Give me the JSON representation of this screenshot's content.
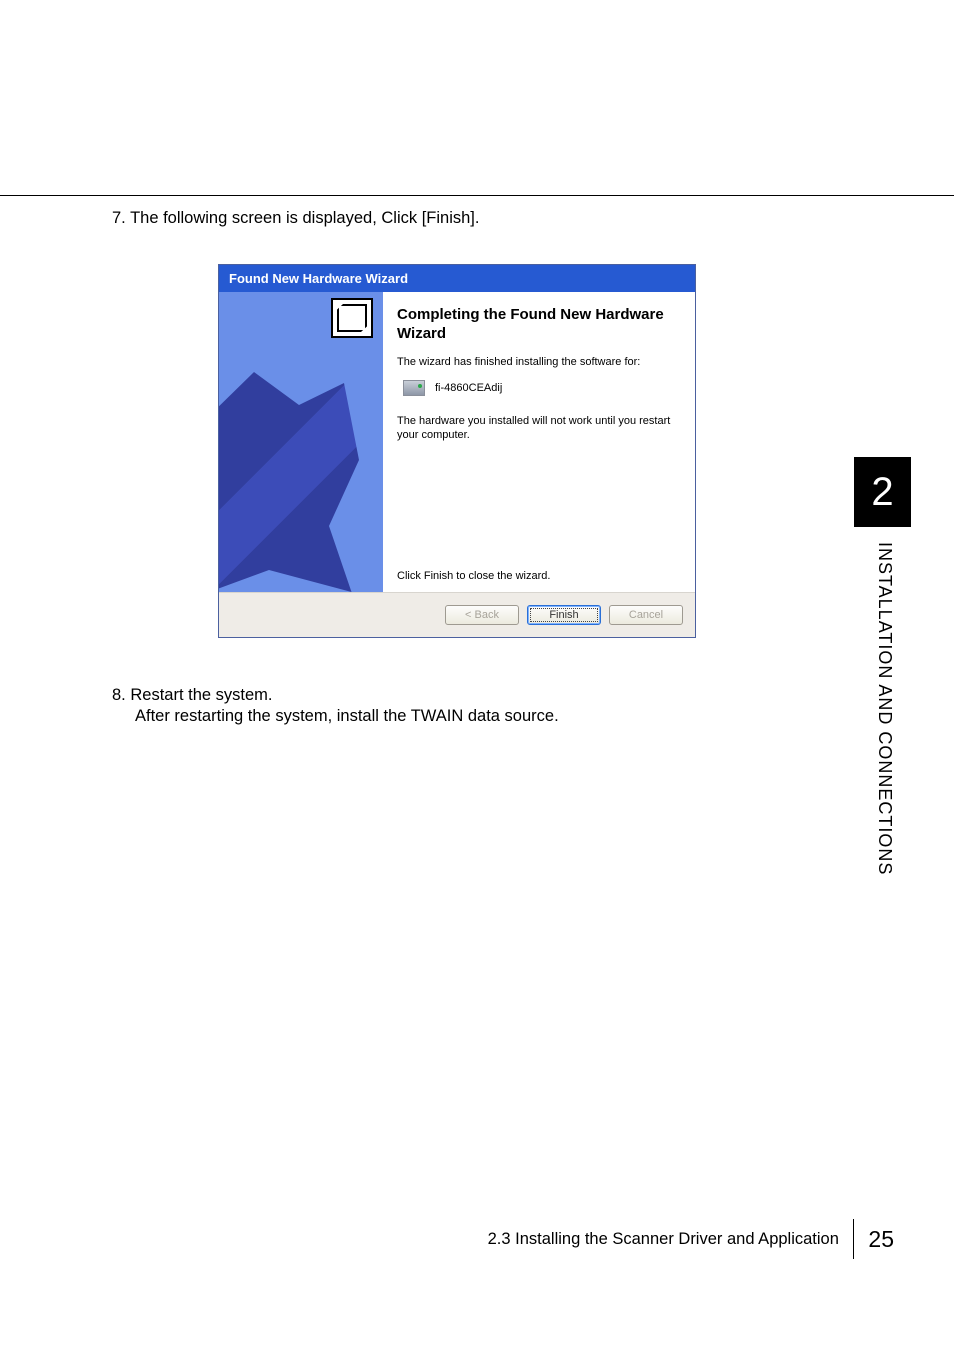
{
  "steps": {
    "s7": {
      "num": "7.",
      "text": "The following screen is displayed, Click [Finish]."
    },
    "s8": {
      "num": "8.",
      "text": "Restart the system.",
      "sub": "After restarting the system, install the TWAIN data source."
    }
  },
  "wizard": {
    "title": "Found New Hardware Wizard",
    "heading": "Completing the Found New Hardware Wizard",
    "sub": "The wizard has finished installing the software for:",
    "device": "fi-4860CEAdij",
    "note": "The hardware you installed will not work until you restart your computer.",
    "close_hint": "Click Finish to close the wizard.",
    "buttons": {
      "back": "< Back",
      "finish": "Finish",
      "cancel": "Cancel"
    }
  },
  "side": {
    "chapter": "2",
    "title": "INSTALLATION AND CONNECTIONS"
  },
  "footer": {
    "section": "2.3 Installing the Scanner Driver and Application",
    "page": "25"
  }
}
